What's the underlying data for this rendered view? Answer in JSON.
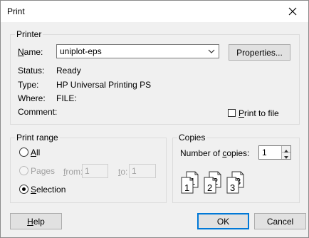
{
  "window": {
    "title": "Print"
  },
  "printer": {
    "group_label": "Printer",
    "name_label": "Name:",
    "name_value": "uniplot-eps",
    "properties_button": "Properties...",
    "status_label": "Status:",
    "status_value": "Ready",
    "type_label": "Type:",
    "type_value": "HP Universal Printing PS",
    "where_label": "Where:",
    "where_value": "FILE:",
    "comment_label": "Comment:",
    "print_to_file_label": "Print to file",
    "print_to_file_checked": false
  },
  "print_range": {
    "group_label": "Print range",
    "all_label": "All",
    "pages_label": "Pages",
    "from_label": "from:",
    "from_value": "1",
    "to_label": "to:",
    "to_value": "1",
    "selection_label": "Selection",
    "selected": "Selection"
  },
  "copies": {
    "group_label": "Copies",
    "number_label": "Number of copies:",
    "number_value": "1",
    "collate_icon": "collate-pages-icon"
  },
  "buttons": {
    "help": "Help",
    "ok": "OK",
    "cancel": "Cancel"
  },
  "icons": [
    "close-icon",
    "chevron-down-icon",
    "spin-up-icon",
    "spin-down-icon",
    "collate-pages-icon"
  ]
}
